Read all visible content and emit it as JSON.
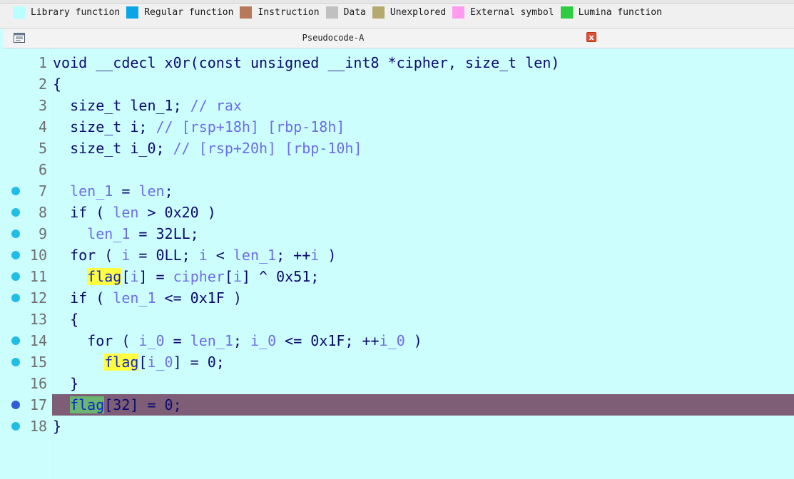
{
  "legend": {
    "items": [
      {
        "label": "Library function",
        "color": "#b8ffff"
      },
      {
        "label": "Regular function",
        "color": "#0aa5e6"
      },
      {
        "label": "Instruction",
        "color": "#b8785a"
      },
      {
        "label": "Data",
        "color": "#c0c0c0"
      },
      {
        "label": "Unexplored",
        "color": "#b4aa70"
      },
      {
        "label": "External symbol",
        "color": "#ff9cf0"
      },
      {
        "label": "Lumina function",
        "color": "#2ecc40"
      }
    ]
  },
  "window": {
    "title": "Pseudocode-A",
    "close_label": "x"
  },
  "code": {
    "lines": [
      {
        "num": "1",
        "bp": false,
        "tokens": [
          {
            "t": "void __cdecl x0r(const unsigned __int8 *cipher, size_t len)",
            "c": "k"
          }
        ]
      },
      {
        "num": "2",
        "bp": false,
        "tokens": [
          {
            "t": "{",
            "c": "k"
          }
        ]
      },
      {
        "num": "3",
        "bp": false,
        "tokens": [
          {
            "t": "  size_t len_1; ",
            "c": "k"
          },
          {
            "t": "// rax",
            "c": "c"
          }
        ]
      },
      {
        "num": "4",
        "bp": false,
        "tokens": [
          {
            "t": "  size_t i; ",
            "c": "k"
          },
          {
            "t": "// [rsp+18h] [rbp-18h]",
            "c": "c"
          }
        ]
      },
      {
        "num": "5",
        "bp": false,
        "tokens": [
          {
            "t": "  size_t i_0; ",
            "c": "k"
          },
          {
            "t": "// [rsp+20h] [rbp-10h]",
            "c": "c"
          }
        ]
      },
      {
        "num": "6",
        "bp": false,
        "tokens": []
      },
      {
        "num": "7",
        "bp": true,
        "tokens": [
          {
            "t": "  ",
            "c": "k"
          },
          {
            "t": "len_1",
            "c": "v"
          },
          {
            "t": " = ",
            "c": "k"
          },
          {
            "t": "len",
            "c": "v"
          },
          {
            "t": ";",
            "c": "k"
          }
        ]
      },
      {
        "num": "8",
        "bp": true,
        "tokens": [
          {
            "t": "  if ( ",
            "c": "k"
          },
          {
            "t": "len",
            "c": "v"
          },
          {
            "t": " > 0x20 )",
            "c": "k"
          }
        ]
      },
      {
        "num": "9",
        "bp": true,
        "tokens": [
          {
            "t": "    ",
            "c": "k"
          },
          {
            "t": "len_1",
            "c": "v"
          },
          {
            "t": " = 32LL;",
            "c": "k"
          }
        ]
      },
      {
        "num": "10",
        "bp": true,
        "tokens": [
          {
            "t": "  for ( ",
            "c": "k"
          },
          {
            "t": "i",
            "c": "v"
          },
          {
            "t": " = 0LL; ",
            "c": "k"
          },
          {
            "t": "i",
            "c": "v"
          },
          {
            "t": " < ",
            "c": "k"
          },
          {
            "t": "len_1",
            "c": "v"
          },
          {
            "t": "; ++",
            "c": "k"
          },
          {
            "t": "i",
            "c": "v"
          },
          {
            "t": " )",
            "c": "k"
          }
        ]
      },
      {
        "num": "11",
        "bp": true,
        "tokens": [
          {
            "t": "    ",
            "c": "k"
          },
          {
            "t": "flag",
            "c": "g"
          },
          {
            "t": "[",
            "c": "k"
          },
          {
            "t": "i",
            "c": "v"
          },
          {
            "t": "] = ",
            "c": "k"
          },
          {
            "t": "cipher",
            "c": "v"
          },
          {
            "t": "[",
            "c": "k"
          },
          {
            "t": "i",
            "c": "v"
          },
          {
            "t": "] ^ 0x51;",
            "c": "k"
          }
        ]
      },
      {
        "num": "12",
        "bp": true,
        "tokens": [
          {
            "t": "  if ( ",
            "c": "k"
          },
          {
            "t": "len_1",
            "c": "v"
          },
          {
            "t": " <= 0x1F )",
            "c": "k"
          }
        ]
      },
      {
        "num": "13",
        "bp": false,
        "tokens": [
          {
            "t": "  {",
            "c": "k"
          }
        ]
      },
      {
        "num": "14",
        "bp": true,
        "tokens": [
          {
            "t": "    for ( ",
            "c": "k"
          },
          {
            "t": "i_0",
            "c": "v"
          },
          {
            "t": " = ",
            "c": "k"
          },
          {
            "t": "len_1",
            "c": "v"
          },
          {
            "t": "; ",
            "c": "k"
          },
          {
            "t": "i_0",
            "c": "v"
          },
          {
            "t": " <= 0x1F; ++",
            "c": "k"
          },
          {
            "t": "i_0",
            "c": "v"
          },
          {
            "t": " )",
            "c": "k"
          }
        ]
      },
      {
        "num": "15",
        "bp": true,
        "tokens": [
          {
            "t": "      ",
            "c": "k"
          },
          {
            "t": "flag",
            "c": "g"
          },
          {
            "t": "[",
            "c": "k"
          },
          {
            "t": "i_0",
            "c": "v"
          },
          {
            "t": "] = 0;",
            "c": "k"
          }
        ]
      },
      {
        "num": "16",
        "bp": false,
        "tokens": [
          {
            "t": "  }",
            "c": "k"
          }
        ]
      },
      {
        "num": "17",
        "bp": true,
        "current": true,
        "tokens": [
          {
            "t": "  ",
            "c": "k"
          },
          {
            "t": "flag",
            "c": "g2"
          },
          {
            "t": "[32] = 0;",
            "c": "k"
          }
        ]
      },
      {
        "num": "18",
        "bp": true,
        "tokens": [
          {
            "t": "}",
            "c": "k"
          }
        ]
      }
    ]
  }
}
